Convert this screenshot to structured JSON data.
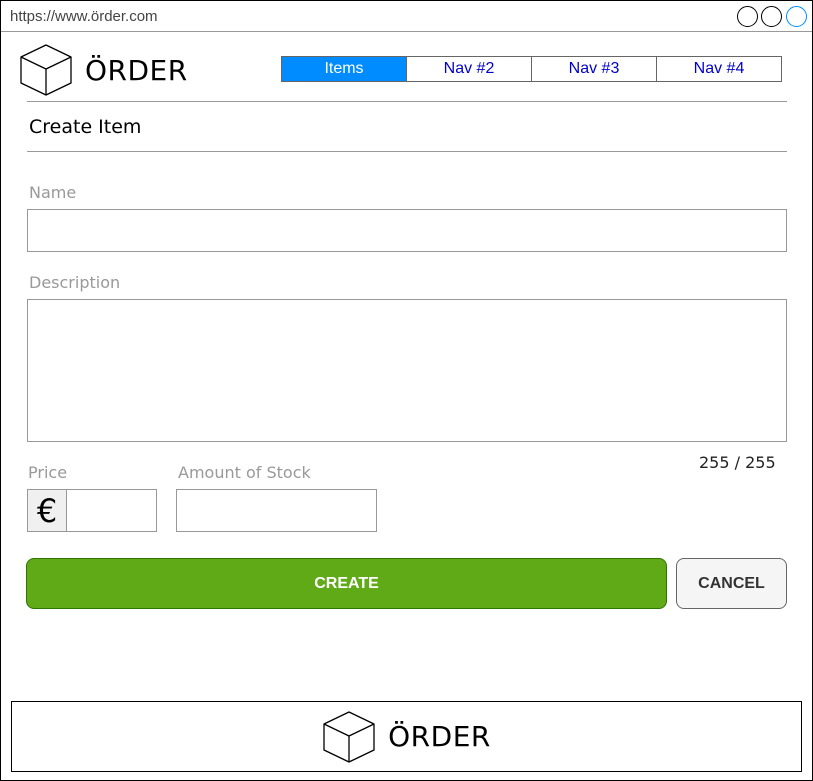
{
  "browser": {
    "url": "https://www.örder.com",
    "window_buttons": [
      "minimize",
      "maximize",
      "close"
    ]
  },
  "header": {
    "logo_text": "ÖRDER",
    "logo_icon": "cube-icon",
    "nav": [
      {
        "label": "Items",
        "active": true
      },
      {
        "label": "Nav #2",
        "active": false
      },
      {
        "label": "Nav #3",
        "active": false
      },
      {
        "label": "Nav #4",
        "active": false
      }
    ]
  },
  "page": {
    "title": "Create Item"
  },
  "form": {
    "name_label": "Name",
    "name_value": "",
    "description_label": "Description",
    "description_value": "",
    "char_counter": "255 / 255",
    "price_label": "Price",
    "price_currency": "€",
    "price_value": "",
    "stock_label": "Amount of Stock",
    "stock_value": ""
  },
  "actions": {
    "create_label": "CREATE",
    "cancel_label": "CANCEL"
  },
  "footer": {
    "logo_text": "ÖRDER",
    "logo_icon": "cube-icon"
  },
  "colors": {
    "nav_active": "#008cff",
    "nav_link": "#0000cc",
    "create_button": "#60a917",
    "label_gray": "#999999"
  }
}
